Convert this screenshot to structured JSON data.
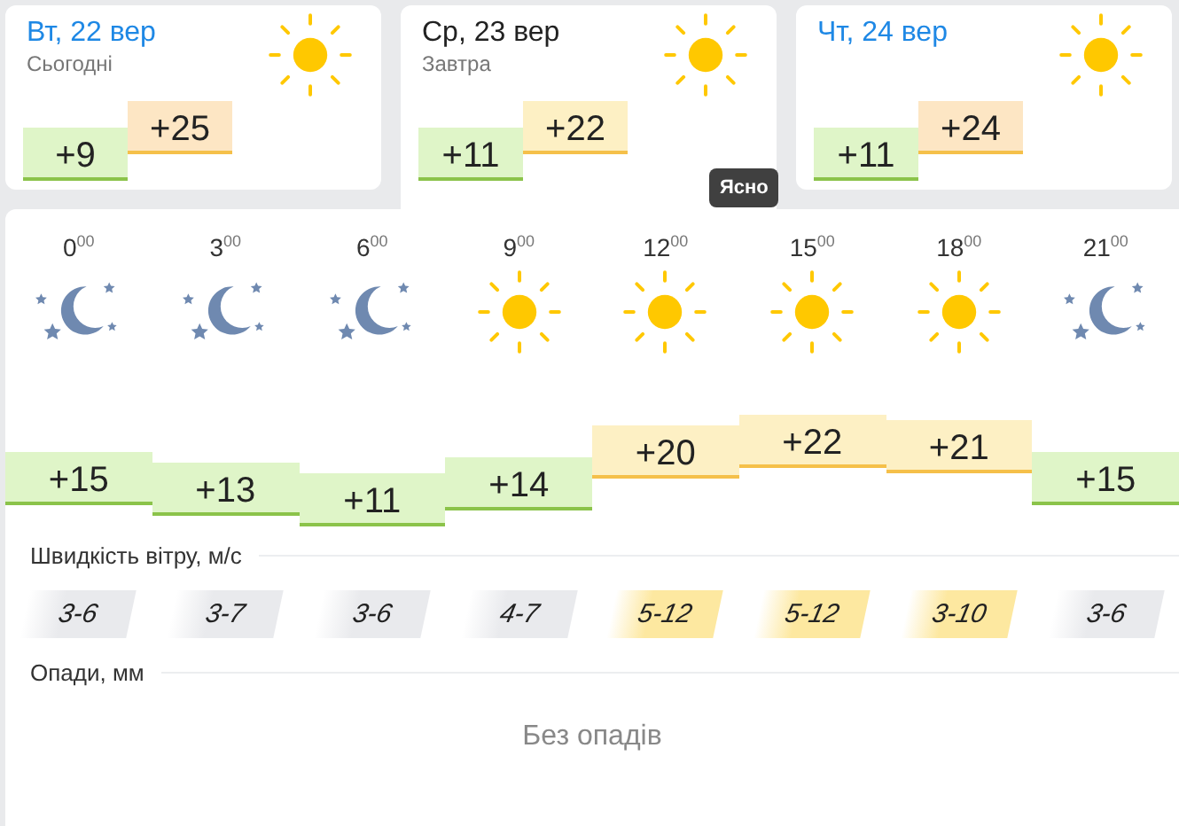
{
  "days": [
    {
      "date": "Вт, 22 вер",
      "note": "Сьогодні",
      "selected": false,
      "min": {
        "temp": "+9",
        "kind": "cool"
      },
      "max": {
        "temp": "+25",
        "kind": "warm"
      }
    },
    {
      "date": "Ср, 23 вер",
      "note": "Завтра",
      "selected": true,
      "min": {
        "temp": "+11",
        "kind": "cool"
      },
      "max": {
        "temp": "+22",
        "kind": "mild"
      }
    },
    {
      "date": "Чт, 24 вер",
      "selected": false,
      "min": {
        "temp": "+11",
        "kind": "cool"
      },
      "max": {
        "temp": "+24",
        "kind": "warm"
      }
    }
  ],
  "tooltip": "Ясно",
  "hours": [
    {
      "time": "0$^{00}$",
      "kind": "night",
      "temp": {
        "text": "+15",
        "kind": "cool"
      }
    },
    {
      "time": "3$^{00}$",
      "kind": "night",
      "temp": {
        "text": "+13",
        "kind": "cool"
      }
    },
    {
      "time": "6$^{00}$",
      "kind": "night",
      "temp": {
        "text": "+11",
        "kind": "cool"
      }
    },
    {
      "time": "9$^{00}$",
      "kind": "day",
      "temp": {
        "text": "+14",
        "kind": "cool"
      }
    },
    {
      "time": "12$^{00}$",
      "kind": "day",
      "temp": {
        "text": "+20",
        "kind": "mild"
      }
    },
    {
      "time": "15$^{00}$",
      "kind": "day",
      "temp": {
        "text": "+22",
        "kind": "mild"
      }
    },
    {
      "time": "18$^{00}$",
      "kind": "day",
      "temp": {
        "text": "+21",
        "kind": "mild"
      }
    },
    {
      "time": "21$^{00}$",
      "kind": "night",
      "temp": {
        "text": "+15",
        "kind": "cool"
      }
    }
  ],
  "wind": {
    "label": "Швидкість вітру, м/с",
    "values": [
      {
        "text": "3-6",
        "kind": "calm"
      },
      {
        "text": "3-7",
        "kind": "calm"
      },
      {
        "text": "3-6",
        "kind": "calm"
      },
      {
        "text": "4-7",
        "kind": "calm"
      },
      {
        "text": "5-12",
        "kind": "strong"
      },
      {
        "text": "5-12",
        "kind": "strong"
      },
      {
        "text": "3-10",
        "kind": "strong"
      },
      {
        "text": "3-6",
        "kind": "calm"
      }
    ]
  },
  "precip": {
    "label": "Опади, мм",
    "text": "Без опадів"
  }
}
